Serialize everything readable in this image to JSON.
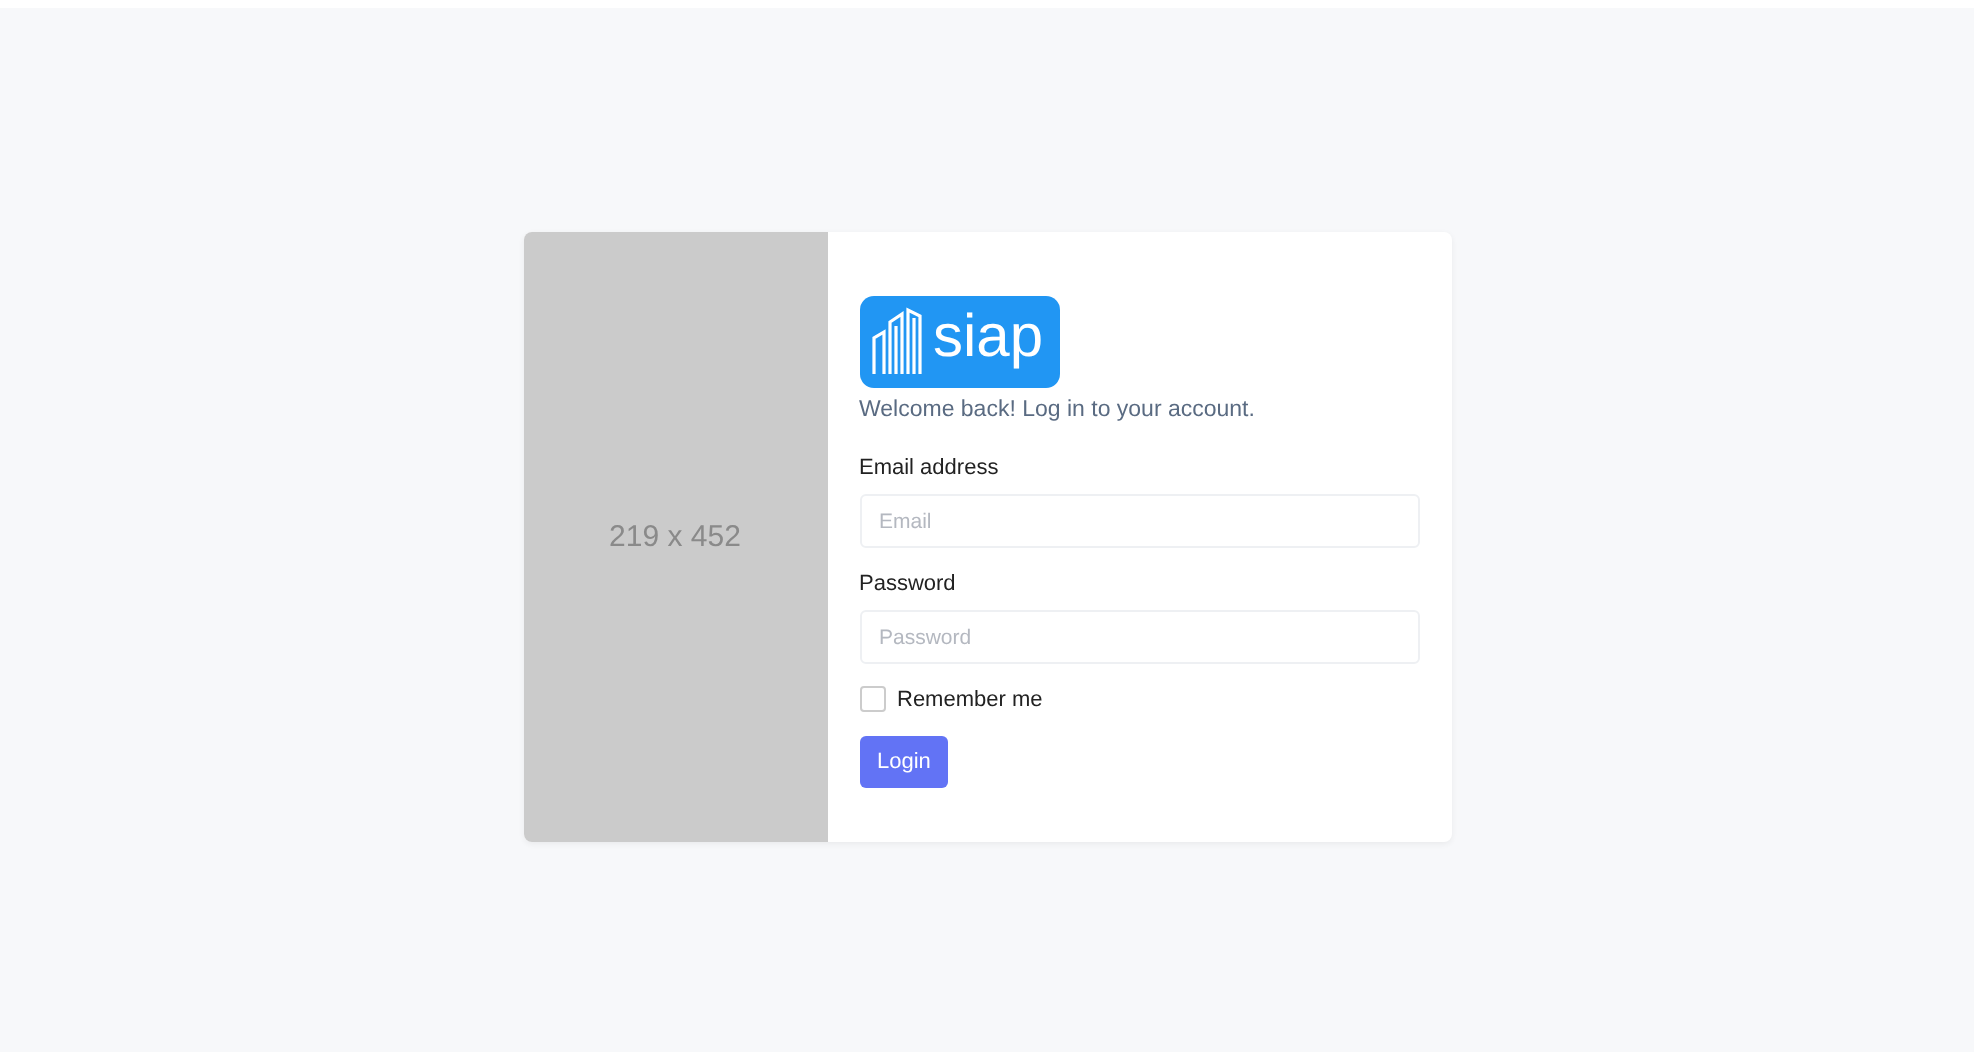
{
  "image_placeholder": {
    "label": "219 x 452"
  },
  "logo": {
    "text": "siap"
  },
  "welcome": "Welcome back! Log in to your account.",
  "fields": [
    {
      "label": "Email address",
      "placeholder": "Email"
    },
    {
      "label": "Password",
      "placeholder": "Password"
    }
  ],
  "remember": {
    "label": "Remember me",
    "checked": false
  },
  "login_button": "Login"
}
